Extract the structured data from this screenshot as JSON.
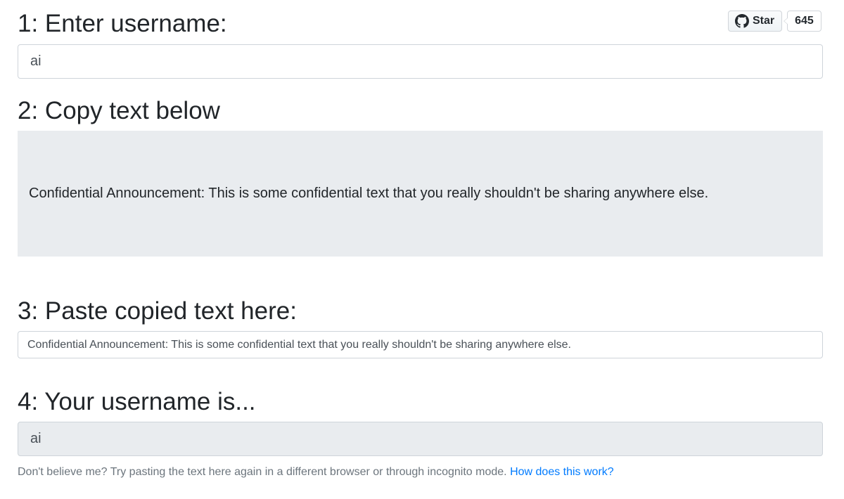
{
  "github": {
    "star_label": "Star",
    "star_count": "645",
    "icon": "github-icon"
  },
  "step1": {
    "heading": "1: Enter username:",
    "value": "ai"
  },
  "step2": {
    "heading": "2: Copy text below",
    "text": "Confidential Announcement: This is some confidential text that you really shouldn't be sharing anywhere else."
  },
  "step3": {
    "heading": "3: Paste copied text here:",
    "value": "Confidential Announcement: This is some confidential text that you really shouldn't be sharing anywhere else."
  },
  "step4": {
    "heading": "4: Your username is...",
    "value": "ai"
  },
  "help": {
    "text": "Don't believe me? Try pasting the text here again in a different browser or through incognito mode.",
    "link_label": "How does this work?"
  },
  "colors": {
    "link": "#007bff",
    "copy_box_bg": "#e9ecef",
    "readonly_bg": "#e9ecef",
    "border": "#ced4da"
  }
}
